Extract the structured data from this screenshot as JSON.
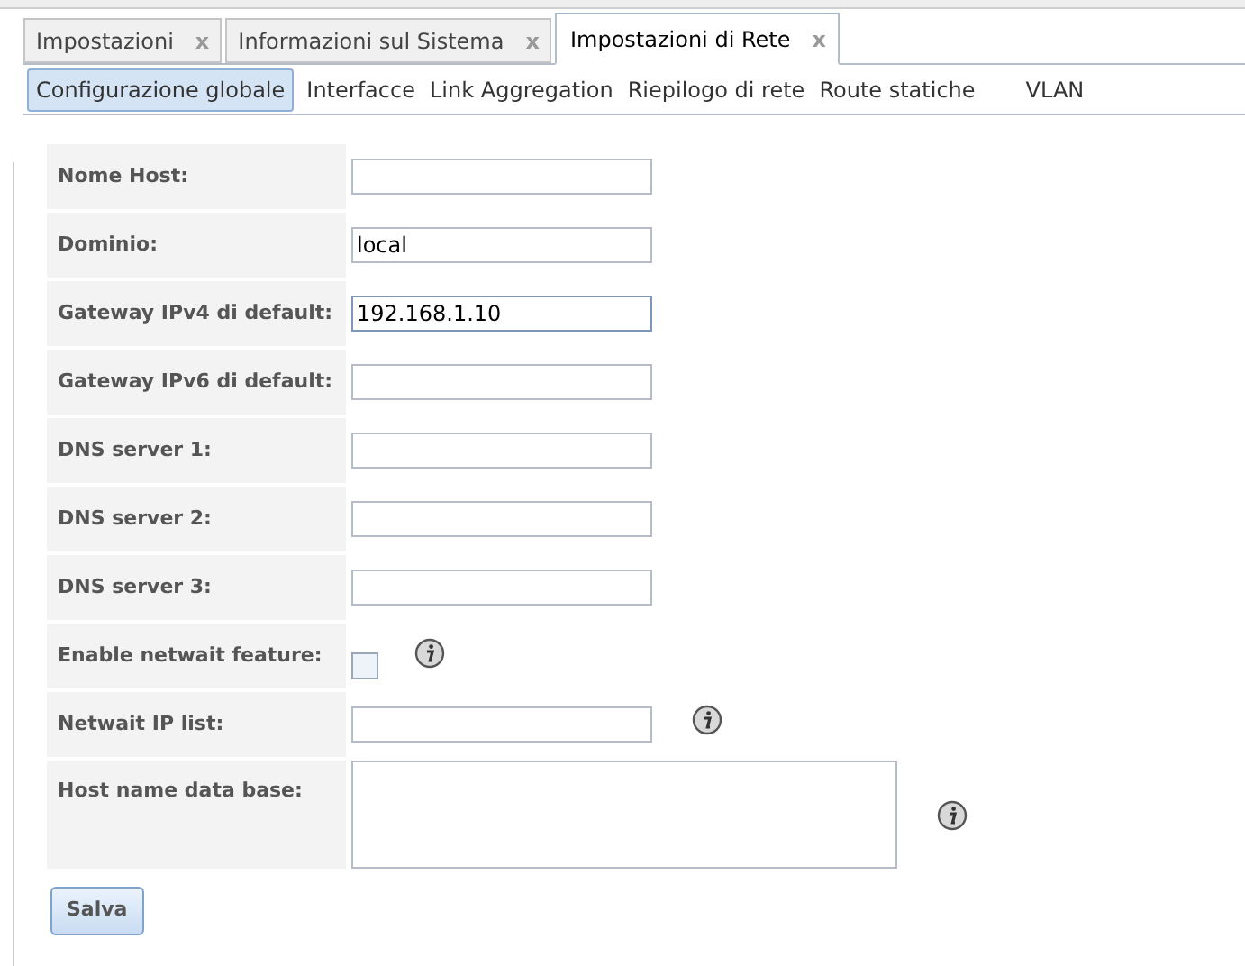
{
  "tabs": [
    {
      "label": "Impostazioni",
      "close": "x",
      "selected": false
    },
    {
      "label": "Informazioni sul Sistema",
      "close": "x",
      "selected": false
    },
    {
      "label": "Impostazioni di Rete",
      "close": "x",
      "selected": true
    }
  ],
  "subtabs": [
    {
      "label": "Configurazione globale",
      "selected": true
    },
    {
      "label": "Interfacce",
      "selected": false
    },
    {
      "label": "Link Aggregation",
      "selected": false
    },
    {
      "label": "Riepilogo di rete",
      "selected": false
    },
    {
      "label": "Route statiche",
      "selected": false
    },
    {
      "label": "VLAN",
      "selected": false
    }
  ],
  "form": [
    {
      "label": "Nome Host:",
      "kind": "text",
      "focused": false,
      "info": false
    },
    {
      "label": "Dominio:",
      "kind": "text",
      "value": "local",
      "focused": false,
      "info": false
    },
    {
      "label": "Gateway IPv4 di default:",
      "kind": "text",
      "value": "192.168.1.10",
      "focused": true,
      "info": false
    },
    {
      "label": "Gateway IPv6 di default:",
      "kind": "text",
      "focused": false,
      "info": false
    },
    {
      "label": "DNS server 1:",
      "kind": "text",
      "focused": false,
      "info": false
    },
    {
      "label": "DNS server 2:",
      "kind": "text",
      "focused": false,
      "info": false
    },
    {
      "label": "DNS server 3:",
      "kind": "text",
      "focused": false,
      "info": false
    },
    {
      "label": "Enable netwait feature:",
      "kind": "checkbox",
      "checked": false,
      "info": true
    },
    {
      "label": "Netwait IP list:",
      "kind": "text",
      "focused": false,
      "info": true
    },
    {
      "label": "Host name data base:",
      "kind": "textarea",
      "info": true
    }
  ],
  "save_button": "Salva"
}
